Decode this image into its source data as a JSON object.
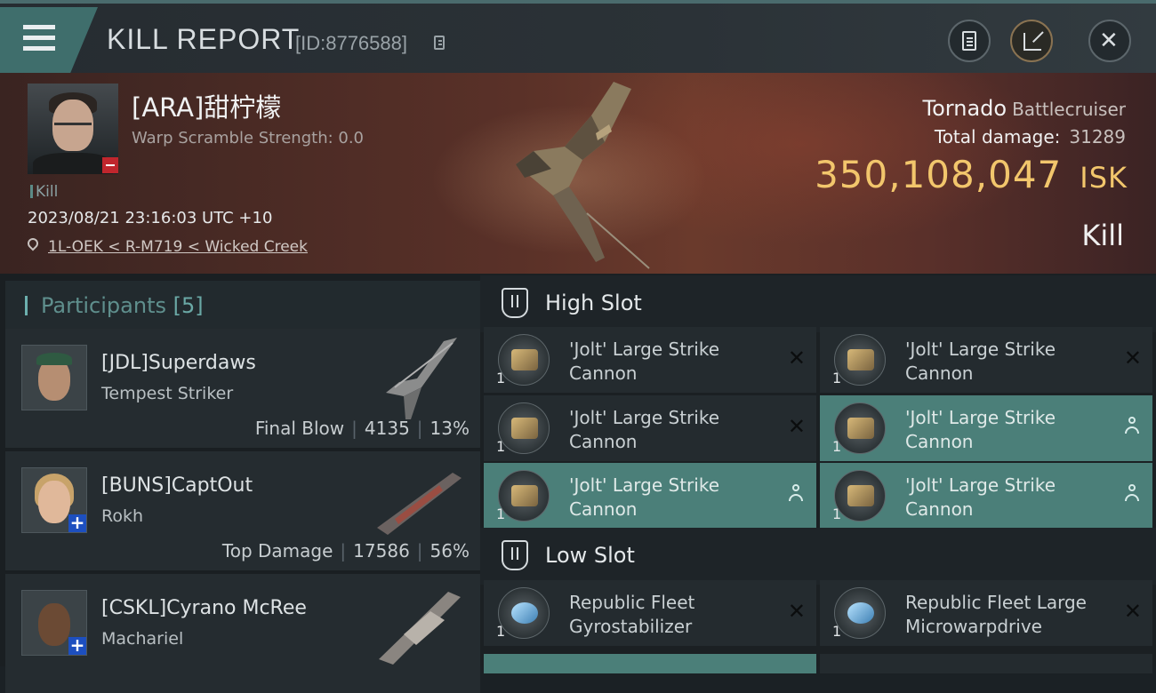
{
  "header": {
    "title": "KILL REPORT",
    "report_id": "[ID:8776588]"
  },
  "victim": {
    "name": "[ARA]甜柠檬",
    "scramble": "Warp Scramble Strength: 0.0",
    "tag": "Kill",
    "timestamp": "2023/08/21 23:16:03 UTC +10",
    "location": "1L-OEK < R-M719 < Wicked Creek ",
    "ship": "Tornado",
    "ship_class": "Battlecruiser",
    "total_damage_label": "Total damage:",
    "total_damage": "31289",
    "isk_value": "350,108,047",
    "isk_unit": "ISK",
    "result": "Kill"
  },
  "participants": {
    "title": "Participants",
    "count": "[5]",
    "rows": [
      {
        "name": "[JDL]Superdaws",
        "ship": "Tempest Striker",
        "role": "Final Blow",
        "damage": "4135",
        "percent": "13%"
      },
      {
        "name": "[BUNS]CaptOut",
        "ship": "Rokh",
        "role": "Top Damage",
        "damage": "17586",
        "percent": "56%"
      },
      {
        "name": "[CSKL]Cyrano McRee",
        "ship": "Machariel",
        "role": "",
        "damage": "",
        "percent": ""
      }
    ]
  },
  "fitting": {
    "high_slot_title": "High Slot",
    "low_slot_title": "Low Slot",
    "high": [
      {
        "name": "'Jolt' Large Strike Cannon",
        "qty": "1"
      },
      {
        "name": "'Jolt' Large Strike Cannon",
        "qty": "1"
      },
      {
        "name": "'Jolt' Large Strike Cannon",
        "qty": "1"
      },
      {
        "name": "'Jolt' Large Strike Cannon",
        "qty": "1"
      },
      {
        "name": "'Jolt' Large Strike Cannon",
        "qty": "1"
      },
      {
        "name": "'Jolt' Large Strike Cannon",
        "qty": "1"
      }
    ],
    "low": [
      {
        "name": "Republic Fleet Gyrostabilizer",
        "qty": "1"
      },
      {
        "name": "Republic Fleet Large Microwarpdrive",
        "qty": "1"
      }
    ]
  },
  "colors": {
    "accent_teal": "#4b7f79",
    "isk_gold": "#f2c66c",
    "minus_badge": "#c0262d",
    "plus_badge": "#1d4fbf"
  }
}
